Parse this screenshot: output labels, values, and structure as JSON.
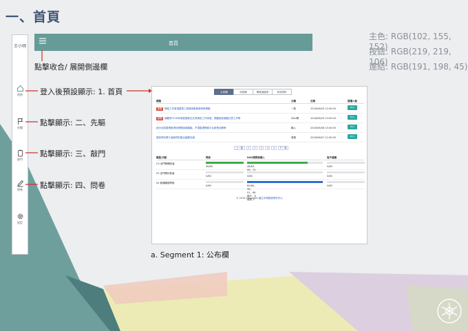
{
  "slide": {
    "title": "一、首頁",
    "colors": [
      "主色: RGB(102, 155, 152)",
      "按鈕: RGB(219, 219, 106)",
      "連結: RGB(191, 198, 45)"
    ],
    "caption": "a. Segment 1: 公布欄",
    "callouts": {
      "toggle": "點擊收合/ 展開側邊欄",
      "home": "登入後預設顯示: 1. 首頁",
      "pioneer": "點擊顯示: 二、先驅",
      "door": "點擊顯示: 三、敲門",
      "survey": "點擊顯示: 四、問卷"
    }
  },
  "app": {
    "user": "王小明",
    "topbar_title": "首頁",
    "brand_color": "#669b98",
    "sidebar": [
      {
        "label": "首頁",
        "icon": "home-icon"
      },
      {
        "label": "先驅",
        "icon": "flag-icon"
      },
      {
        "label": "敲門",
        "icon": "door-icon"
      },
      {
        "label": "問卷",
        "icon": "pencil-icon"
      },
      {
        "label": "設定",
        "icon": "gear-icon"
      }
    ]
  },
  "screenshot": {
    "tabs": [
      "公布欄",
      "訊息欄",
      "問卷進度表",
      "有效資料"
    ],
    "announcements": {
      "headers": [
        "標題",
        "分類",
        "日期",
        "閱讀人數"
      ],
      "rows": [
        {
          "tag": "重要",
          "title": "問卷工作事項暨員工與專家動員條例等規範",
          "category": "一般",
          "date": "2016/06/03 12:00:00",
          "action": "65人"
        },
        {
          "tag": "重要",
          "title": "總體會2018年家庭與數位社會調查工作事項，提醒各區推動社會工作等",
          "category": "DAU問",
          "date": "2016/06/03 10:00:00",
          "action": "65人"
        },
        {
          "tag": "",
          "title": "部分訪談整理與資料問題回報建議，不須監理問卷平台政策註解等",
          "category": "輸入",
          "date": "2016/06/08 15:00:00",
          "action": "64人"
        },
        {
          "tag": "",
          "title": "調查資料庫介面與資料整合議題討論",
          "category": "事務",
          "date": "2016/06/07 12:00:00",
          "action": "65人"
        }
      ]
    },
    "pagination": [
      "上一頁",
      "1",
      "2",
      "3",
      "4",
      "5",
      "下一頁"
    ],
    "progress": {
      "headers": [
        "類型/次數",
        "問卷",
        "DAU調問卷輸入",
        "客戶建議"
      ],
      "rows": [
        {
          "name": "CS 全門牌確知者",
          "c1": {
            "pct": 100,
            "label": "48/60",
            "color": "#3cab48"
          },
          "c2": {
            "pct": 80,
            "label": "48/60，06，74",
            "color": "#3cab48"
          },
          "c3": {
            "pct": 0,
            "label": "0/80",
            "color": "#3cab48"
          }
        },
        {
          "name": "S3 全門牌計數者",
          "c1": {
            "pct": 0,
            "label": "0/80",
            "color": "#3cab48"
          },
          "c2": {
            "pct": 0,
            "label": "0/80",
            "color": "#3cab48"
          },
          "c3": {
            "pct": 0,
            "label": "0/80",
            "color": "#3cab48"
          }
        },
        {
          "name": "S4 普通職員問卷",
          "c1": {
            "pct": 0,
            "label": "0/80",
            "color": "#2e6fce"
          },
          "c2": {
            "pct": 100,
            "label": "80/80，98，91，86客戶，8填表 2",
            "color": "#2e6fce"
          },
          "c3": {
            "pct": 0,
            "label": "0/80",
            "color": "#2e6fce"
          }
        }
      ]
    },
    "footer": "© 2016 Copyright",
    "footer_link": "國立中興調查研究中心"
  }
}
